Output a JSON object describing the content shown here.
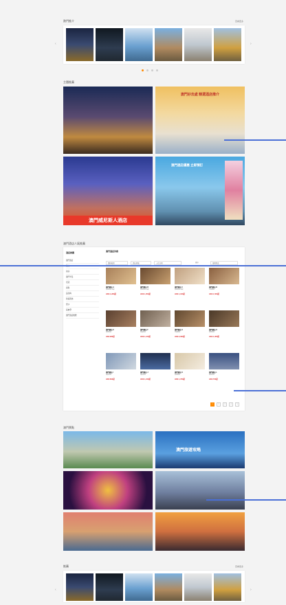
{
  "top_strip": {
    "title": "熱門推介",
    "more": "查看更多"
  },
  "featured": {
    "title": "主題推薦",
    "banner_tr_title": "澳門好去處 精選酒店推介",
    "banner_bl_caption": "澳門威尼斯人酒店",
    "banner_br_title": "澳門酒店優惠 立即預訂"
  },
  "hotels": {
    "title": "澳門酒店人氣推薦",
    "side_header": "酒店推薦",
    "side_items": [
      "澳門酒店",
      "路氹",
      "氹仔",
      "澳門半島",
      "皇冠",
      "永利",
      "美高梅",
      "新濠天地",
      "金沙",
      "喜來登",
      "澳門酒店推薦"
    ],
    "grid_header": "澳門酒店列表",
    "filters": [
      "價格範圍",
      "酒店星級",
      "入住日期",
      "排序",
      "推薦程度"
    ],
    "items": [
      {
        "name": "澳門酒店 A",
        "desc": "豪華客房 海景",
        "price": "HK$ 1,280起"
      },
      {
        "name": "澳門酒店 B",
        "desc": "豪華客房 海景",
        "price": "HK$ 1,350起"
      },
      {
        "name": "澳門酒店 C",
        "desc": "豪華客房 城景",
        "price": "HK$ 1,180起"
      },
      {
        "name": "澳門酒店 D",
        "desc": "行政套房",
        "price": "HK$ 1,560起"
      },
      {
        "name": "澳門酒店 E",
        "desc": "豪華客房",
        "price": "HK$ 980起"
      },
      {
        "name": "澳門酒店 F",
        "desc": "家庭客房",
        "price": "HK$ 1,120起"
      },
      {
        "name": "澳門酒店 G",
        "desc": "尊貴套房",
        "price": "HK$ 2,080起"
      },
      {
        "name": "澳門酒店 H",
        "desc": "豪華客房",
        "price": "HK$ 1,060起"
      },
      {
        "name": "澳門酒店 I",
        "desc": "城景客房",
        "price": "HK$ 890起"
      },
      {
        "name": "澳門酒店 J",
        "desc": "海景客房",
        "price": "HK$ 1,240起"
      },
      {
        "name": "澳門酒店 K",
        "desc": "豪華套房",
        "price": "HK$ 1,780起"
      },
      {
        "name": "澳門酒店 L",
        "desc": "標準客房",
        "price": "HK$ 760起"
      }
    ],
    "pages": [
      "1",
      "2",
      "3",
      "4",
      "5"
    ]
  },
  "gallery": {
    "title": "澳門景點",
    "caption_tr": "澳門旅遊攻略"
  },
  "bottom_strip": {
    "title": "推薦",
    "more": "查看更多"
  },
  "colors": {
    "accent": "#ff8a00",
    "annotation": "#4a6fd6",
    "price": "#d33333"
  }
}
